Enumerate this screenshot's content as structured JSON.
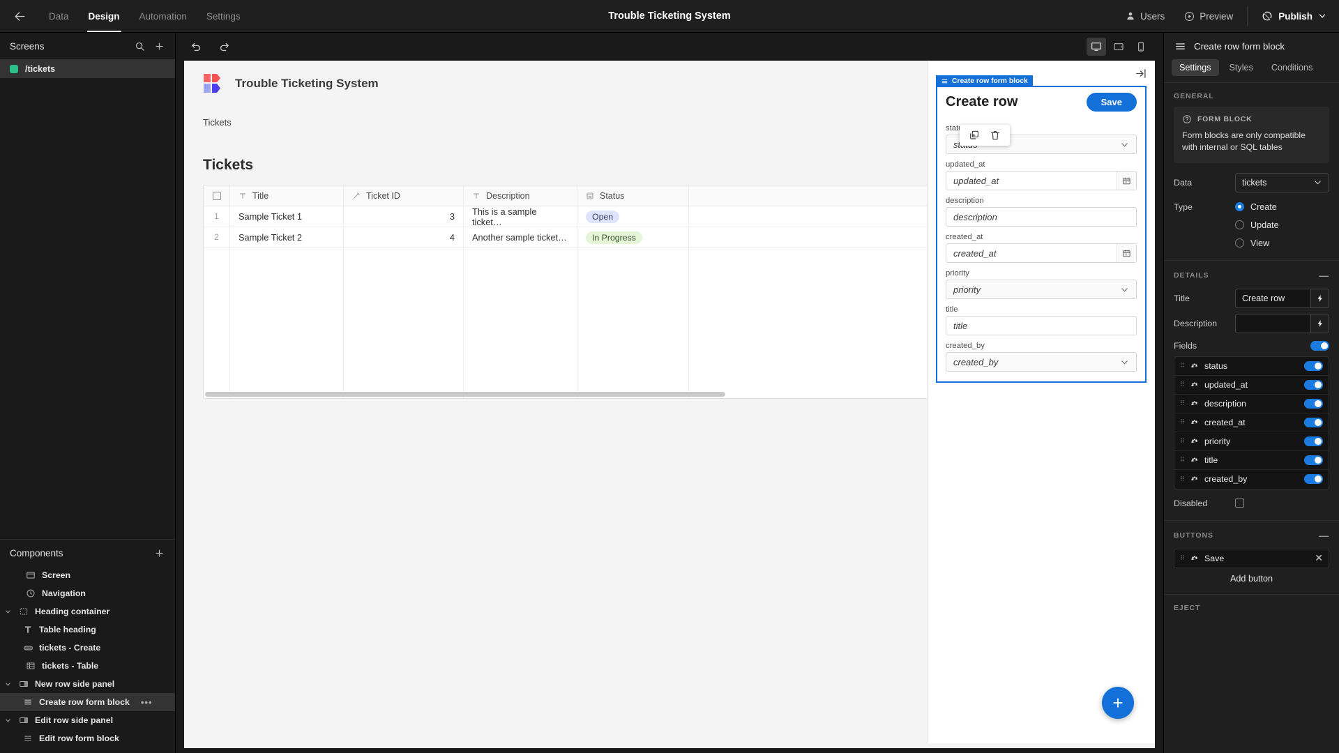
{
  "topbar": {
    "back_icon": "arrow-left-icon",
    "tabs": [
      {
        "label": "Data",
        "active": false
      },
      {
        "label": "Design",
        "active": true
      },
      {
        "label": "Automation",
        "active": false
      },
      {
        "label": "Settings",
        "active": false
      }
    ],
    "app_title": "Trouble Ticketing System",
    "users_label": "Users",
    "preview_label": "Preview",
    "publish_label": "Publish"
  },
  "left_panel": {
    "screens_title": "Screens",
    "search_icon": "search-icon",
    "add_icon": "plus-icon",
    "screens": [
      {
        "label": "/tickets",
        "color": "#2ec08b",
        "selected": true
      }
    ],
    "components_title": "Components",
    "components_add_icon": "plus-icon",
    "components": [
      {
        "label": "Screen",
        "icon": "screen-icon",
        "indent": 0,
        "caret": "",
        "selected": false
      },
      {
        "label": "Navigation",
        "icon": "navigation-icon",
        "indent": 0,
        "caret": "",
        "selected": false
      },
      {
        "label": "Heading container",
        "icon": "container-icon",
        "indent": 0,
        "caret": "down",
        "selected": false
      },
      {
        "label": "Table heading",
        "icon": "text-icon",
        "indent": 1,
        "caret": "",
        "selected": false
      },
      {
        "label": "tickets - Create",
        "icon": "button-icon",
        "indent": 1,
        "caret": "",
        "selected": false
      },
      {
        "label": "tickets - Table",
        "icon": "table-icon",
        "indent": 0,
        "caret": "",
        "selected": false
      },
      {
        "label": "New row side panel",
        "icon": "sidepanel-icon",
        "indent": 0,
        "caret": "down",
        "selected": false
      },
      {
        "label": "Create row form block",
        "icon": "formblock-icon",
        "indent": 1,
        "caret": "",
        "selected": true,
        "more": "•••"
      },
      {
        "label": "Edit row side panel",
        "icon": "sidepanel-icon",
        "indent": 0,
        "caret": "down",
        "selected": false
      },
      {
        "label": "Edit row form block",
        "icon": "formblock-icon",
        "indent": 1,
        "caret": "",
        "selected": false
      }
    ]
  },
  "canvas": {
    "undo_icon": "undo-icon",
    "redo_icon": "redo-icon",
    "devices": [
      {
        "name": "desktop-icon",
        "active": true
      },
      {
        "name": "tablet-icon",
        "active": false
      },
      {
        "name": "mobile-icon",
        "active": false
      }
    ],
    "app": {
      "logo": "budibase-logo",
      "header_title": "Trouble Ticketing System",
      "nav_item": "Tickets",
      "table_heading": "Tickets",
      "table": {
        "columns": [
          {
            "label": "Title",
            "icon": "text-column-icon"
          },
          {
            "label": "Ticket ID",
            "icon": "formula-column-icon"
          },
          {
            "label": "Description",
            "icon": "text-column-icon"
          },
          {
            "label": "Status",
            "icon": "options-column-icon"
          }
        ],
        "rows": [
          {
            "n": "1",
            "title": "Sample Ticket 1",
            "ticket_id": "3",
            "description": "This is a sample ticket…",
            "status": "Open",
            "status_style": "open"
          },
          {
            "n": "2",
            "title": "Sample Ticket 2",
            "ticket_id": "4",
            "description": "Another sample ticket…",
            "status": "In Progress",
            "status_style": "progress"
          }
        ]
      },
      "fab_label": "+"
    },
    "hover_tools": [
      {
        "name": "duplicate-icon"
      },
      {
        "name": "delete-icon"
      }
    ],
    "side_panel": {
      "collapse_icon": "collapse-panel-icon",
      "block_tag": "Create row form block",
      "form_title": "Create row",
      "save_label": "Save",
      "fields": [
        {
          "label": "status",
          "placeholder": "status",
          "type": "select"
        },
        {
          "label": "updated_at",
          "placeholder": "updated_at",
          "type": "date"
        },
        {
          "label": "description",
          "placeholder": "description",
          "type": "text"
        },
        {
          "label": "created_at",
          "placeholder": "created_at",
          "type": "date"
        },
        {
          "label": "priority",
          "placeholder": "priority",
          "type": "select"
        },
        {
          "label": "title",
          "placeholder": "title",
          "type": "text"
        },
        {
          "label": "created_by",
          "placeholder": "created_by",
          "type": "select"
        }
      ]
    }
  },
  "right_panel": {
    "menu_icon": "hamburger-icon",
    "title": "Create row form block",
    "tabs": [
      {
        "label": "Settings",
        "active": true
      },
      {
        "label": "Styles",
        "active": false
      },
      {
        "label": "Conditions",
        "active": false
      }
    ],
    "general": {
      "section_label": "GENERAL",
      "info_icon": "question-circle-icon",
      "info_title": "FORM BLOCK",
      "info_text": "Form blocks are only compatible with internal or SQL tables",
      "data_label": "Data",
      "data_value": "tickets",
      "type_label": "Type",
      "type_options": [
        {
          "label": "Create",
          "selected": true
        },
        {
          "label": "Update",
          "selected": false
        },
        {
          "label": "View",
          "selected": false
        }
      ]
    },
    "details": {
      "section_label": "DETAILS",
      "collapse_icon": "minus-icon",
      "title_label": "Title",
      "title_value": "Create row",
      "description_label": "Description",
      "description_value": "",
      "binding_icon": "lightning-icon",
      "fields_label": "Fields",
      "fields_enabled": true,
      "fields": [
        {
          "name": "status",
          "enabled": true
        },
        {
          "name": "updated_at",
          "enabled": true
        },
        {
          "name": "description",
          "enabled": true
        },
        {
          "name": "created_at",
          "enabled": true
        },
        {
          "name": "priority",
          "enabled": true
        },
        {
          "name": "title",
          "enabled": true
        },
        {
          "name": "created_by",
          "enabled": true
        }
      ],
      "disabled_label": "Disabled",
      "disabled_checked": false
    },
    "buttons": {
      "section_label": "BUTTONS",
      "collapse_icon": "minus-icon",
      "items": [
        {
          "name": "Save"
        }
      ],
      "add_label": "Add button"
    },
    "eject": {
      "section_label": "EJECT"
    },
    "accent": "#1a7ce0"
  }
}
